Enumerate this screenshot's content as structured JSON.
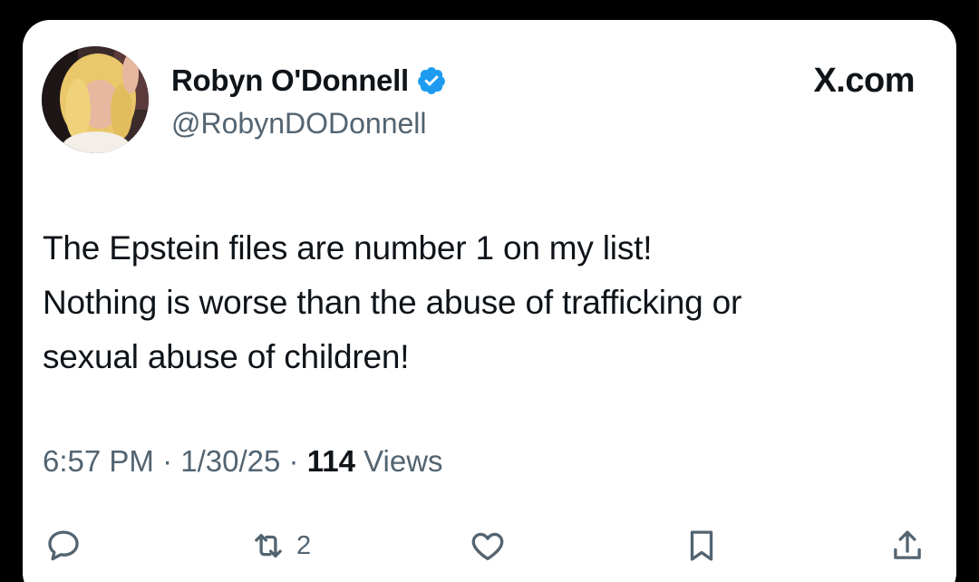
{
  "tweet": {
    "author": {
      "display_name": "Robyn O'Donnell",
      "handle": "@RobynDODonnell",
      "verified": true,
      "avatar_icon": "profile-photo"
    },
    "brand": "X.com",
    "text_lines": [
      "The Epstein files are number 1 on my list!",
      "Nothing is worse than the abuse of trafficking or",
      "sexual abuse of children!"
    ],
    "meta": {
      "time": "6:57 PM",
      "separator": "·",
      "date": "1/30/25",
      "views_count": "114",
      "views_label": "Views"
    },
    "actions": {
      "reply": {
        "icon": "reply-icon"
      },
      "repost": {
        "icon": "repost-icon",
        "count": "2"
      },
      "like": {
        "icon": "like-icon"
      },
      "bookmark": {
        "icon": "bookmark-icon"
      },
      "share": {
        "icon": "share-icon"
      }
    }
  },
  "colors": {
    "text_primary": "#0f1419",
    "text_secondary": "#536471",
    "verified_blue": "#1d9bf0",
    "background": "#000000",
    "card": "#ffffff"
  }
}
